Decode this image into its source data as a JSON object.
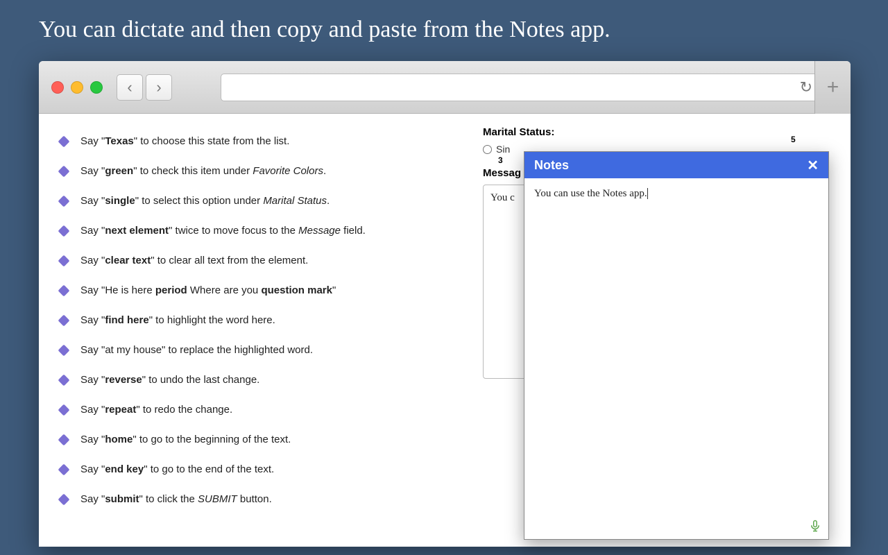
{
  "banner": "You can dictate and then copy and paste from the Notes app.",
  "instructions": [
    {
      "pre": "Say \"",
      "b1": "Texas",
      "mid": "\" to choose this state from the list.",
      "b2": "",
      "tail": ""
    },
    {
      "pre": "Say \"",
      "b1": "green",
      "mid": "\" to check this item under ",
      "i1": "Favorite Colors",
      "tail": "."
    },
    {
      "pre": "Say \"",
      "b1": "single",
      "mid": "\" to select this option under ",
      "i1": "Marital Status",
      "tail": "."
    },
    {
      "pre": "Say \"",
      "b1": "next element",
      "mid": "\" twice to move focus to the ",
      "i1": "Message",
      "tail": " field."
    },
    {
      "pre": "Say \"",
      "b1": "clear text",
      "mid": "\" to clear all text from the element.",
      "tail": ""
    },
    {
      "pre": "Say \"He is here ",
      "b1": "period",
      "mid": " Where are you ",
      "b2": "question mark",
      "tail": "\""
    },
    {
      "pre": "Say \"",
      "b1": "find here",
      "mid": "\" to highlight the word here.",
      "tail": ""
    },
    {
      "pre": "Say \"at my house\" to replace the highlighted word.",
      "b1": "",
      "mid": "",
      "tail": ""
    },
    {
      "pre": "Say \"",
      "b1": "reverse",
      "mid": "\" to undo the last change.",
      "tail": ""
    },
    {
      "pre": "Say \"",
      "b1": "repeat",
      "mid": "\" to redo the change.",
      "tail": ""
    },
    {
      "pre": "Say \"",
      "b1": "home",
      "mid": "\" to go to the beginning of the text.",
      "tail": ""
    },
    {
      "pre": "Say \"",
      "b1": "end key",
      "mid": "\" to go to the end of the text.",
      "tail": ""
    },
    {
      "pre": "Say \"",
      "b1": "submit",
      "mid": "\" to click the ",
      "i1": "SUBMIT",
      "tail": " button."
    }
  ],
  "form": {
    "marital_label": "Marital Status:",
    "radio_single": "Sin",
    "overlay_3": "3",
    "overlay_5": "5",
    "message_label": "Messag",
    "message_body": "You c"
  },
  "notes": {
    "title": "Notes",
    "body": "You can use the Notes app."
  }
}
